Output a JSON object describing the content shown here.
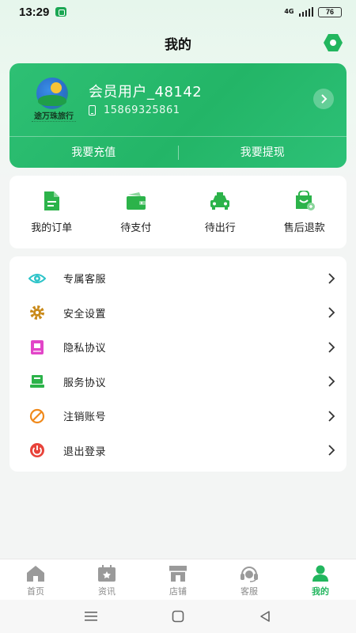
{
  "status_bar": {
    "time": "13:29",
    "network": "4G",
    "battery": "76"
  },
  "header": {
    "title": "我的",
    "settings_icon": "hexagon-settings-icon"
  },
  "member_card": {
    "logo_text": "途万珠旅行",
    "username": "会员用户_48142",
    "phone": "15869325861",
    "actions": [
      {
        "label": "我要充值"
      },
      {
        "label": "我要提现"
      }
    ]
  },
  "orders": [
    {
      "label": "我的订单",
      "icon": "document-icon"
    },
    {
      "label": "待支付",
      "icon": "wallet-icon"
    },
    {
      "label": "待出行",
      "icon": "taxi-icon"
    },
    {
      "label": "售后退款",
      "icon": "shopping-bag-icon"
    }
  ],
  "menu": [
    {
      "label": "专属客服",
      "icon": "eye-icon",
      "color": "#2cc3c8"
    },
    {
      "label": "安全设置",
      "icon": "gear-icon",
      "color": "#c98a1a"
    },
    {
      "label": "隐私协议",
      "icon": "privacy-icon",
      "color": "#e245c8"
    },
    {
      "label": "服务协议",
      "icon": "laptop-icon",
      "color": "#2cb34a"
    },
    {
      "label": "注销账号",
      "icon": "prohibit-icon",
      "color": "#f08a1c"
    },
    {
      "label": "退出登录",
      "icon": "power-icon",
      "color": "#e8433a"
    }
  ],
  "bottom_nav": [
    {
      "label": "首页",
      "icon": "home-icon"
    },
    {
      "label": "资讯",
      "icon": "news-icon"
    },
    {
      "label": "店铺",
      "icon": "store-icon"
    },
    {
      "label": "客服",
      "icon": "headset-icon"
    },
    {
      "label": "我的",
      "icon": "profile-icon",
      "active": true
    }
  ],
  "colors": {
    "accent": "#22b65e",
    "card_gradient_start": "#2ec074",
    "card_gradient_end": "#23b567"
  }
}
